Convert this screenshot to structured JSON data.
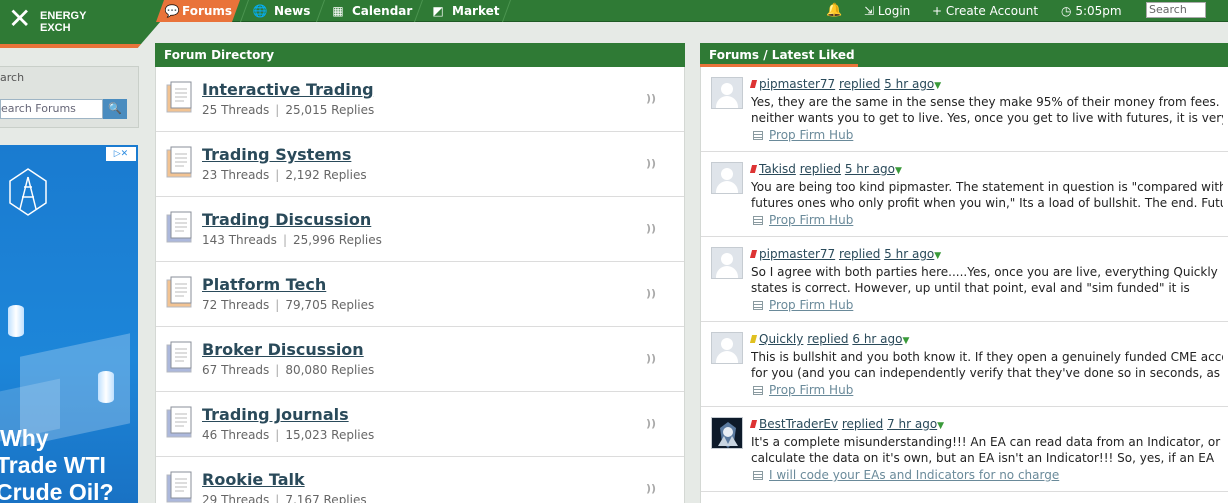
{
  "topnav": {
    "logo_line1": "ENERGY",
    "logo_line2": "EXCH",
    "tabs": [
      {
        "label": "Forums",
        "icon": "chat-bubbles-icon",
        "active": true
      },
      {
        "label": "News",
        "icon": "globe-icon"
      },
      {
        "label": "Calendar",
        "icon": "calendar-icon"
      },
      {
        "label": "Market",
        "icon": "chart-icon"
      }
    ],
    "login": "Login",
    "create_account": "Create Account",
    "time": "5:05pm",
    "search_placeholder": "Search"
  },
  "sidebar": {
    "search_label": "arch",
    "search_placeholder": "earch Forums",
    "ad_text_lines": [
      "Why",
      "Trade WTI",
      "Crude Oil?"
    ]
  },
  "forum_directory": {
    "title": "Forum Directory",
    "forums": [
      {
        "name": "Interactive Trading",
        "threads": "25 Threads",
        "replies": "25,015 Replies",
        "icon": "orange"
      },
      {
        "name": "Trading Systems",
        "threads": "23 Threads",
        "replies": "2,192 Replies",
        "icon": "orange"
      },
      {
        "name": "Trading Discussion",
        "threads": "143 Threads",
        "replies": "25,996 Replies",
        "icon": "blue"
      },
      {
        "name": "Platform Tech",
        "threads": "72 Threads",
        "replies": "79,705 Replies",
        "icon": "orange"
      },
      {
        "name": "Broker Discussion",
        "threads": "67 Threads",
        "replies": "80,080 Replies",
        "icon": "blue"
      },
      {
        "name": "Trading Journals",
        "threads": "46 Threads",
        "replies": "15,023 Replies",
        "icon": "blue"
      },
      {
        "name": "Rookie Talk",
        "threads": "29 Threads",
        "replies": "7,167 Replies",
        "icon": "blue"
      }
    ]
  },
  "latest_liked": {
    "title": "Forums / Latest Liked",
    "posts": [
      {
        "user": "pipmaster77",
        "action": "replied",
        "time": "5 hr ago",
        "flag": "red",
        "line1": "Yes, they are the same in the sense they make 95% of their money from fees.",
        "line2": "neither wants you to get to live. Yes, once you get to live with futures, it is very",
        "thread": "Prop Firm Hub",
        "avatar": "default"
      },
      {
        "user": "Takisd",
        "action": "replied",
        "time": "5 hr ago",
        "flag": "red",
        "line1": "You are being too kind pipmaster. The statement in question is \"compared with the",
        "line2": "futures ones who only profit when you win,\" Its a load of bullshit. The end. Futures",
        "thread": "Prop Firm Hub",
        "avatar": "default"
      },
      {
        "user": "pipmaster77",
        "action": "replied",
        "time": "5 hr ago",
        "flag": "red",
        "line1": "So I agree with both parties here.....Yes, once you are live, everything Quickly",
        "line2": "states is correct. However, up until that point, eval and \"sim funded\" it is",
        "thread": "Prop Firm Hub",
        "avatar": "default"
      },
      {
        "user": "Quickly",
        "action": "replied",
        "time": "6 hr ago",
        "flag": "yellow",
        "line1": "This is bullshit and you both know it. If they open a genuinely funded CME account",
        "line2": "for you (and you can independently verify that they've done so in seconds, as so",
        "thread": "Prop Firm Hub",
        "avatar": "default"
      },
      {
        "user": "BestTraderEv",
        "action": "replied",
        "time": "7 hr ago",
        "flag": "red",
        "line1": "It's a complete misunderstanding!!! An EA can read data from an Indicator, or",
        "line2": "calculate the data on it's own, but an EA isn't an Indicator!!! So, yes, if an EA",
        "thread": "I will code your EAs and Indicators for no charge",
        "avatar": "image"
      }
    ]
  }
}
